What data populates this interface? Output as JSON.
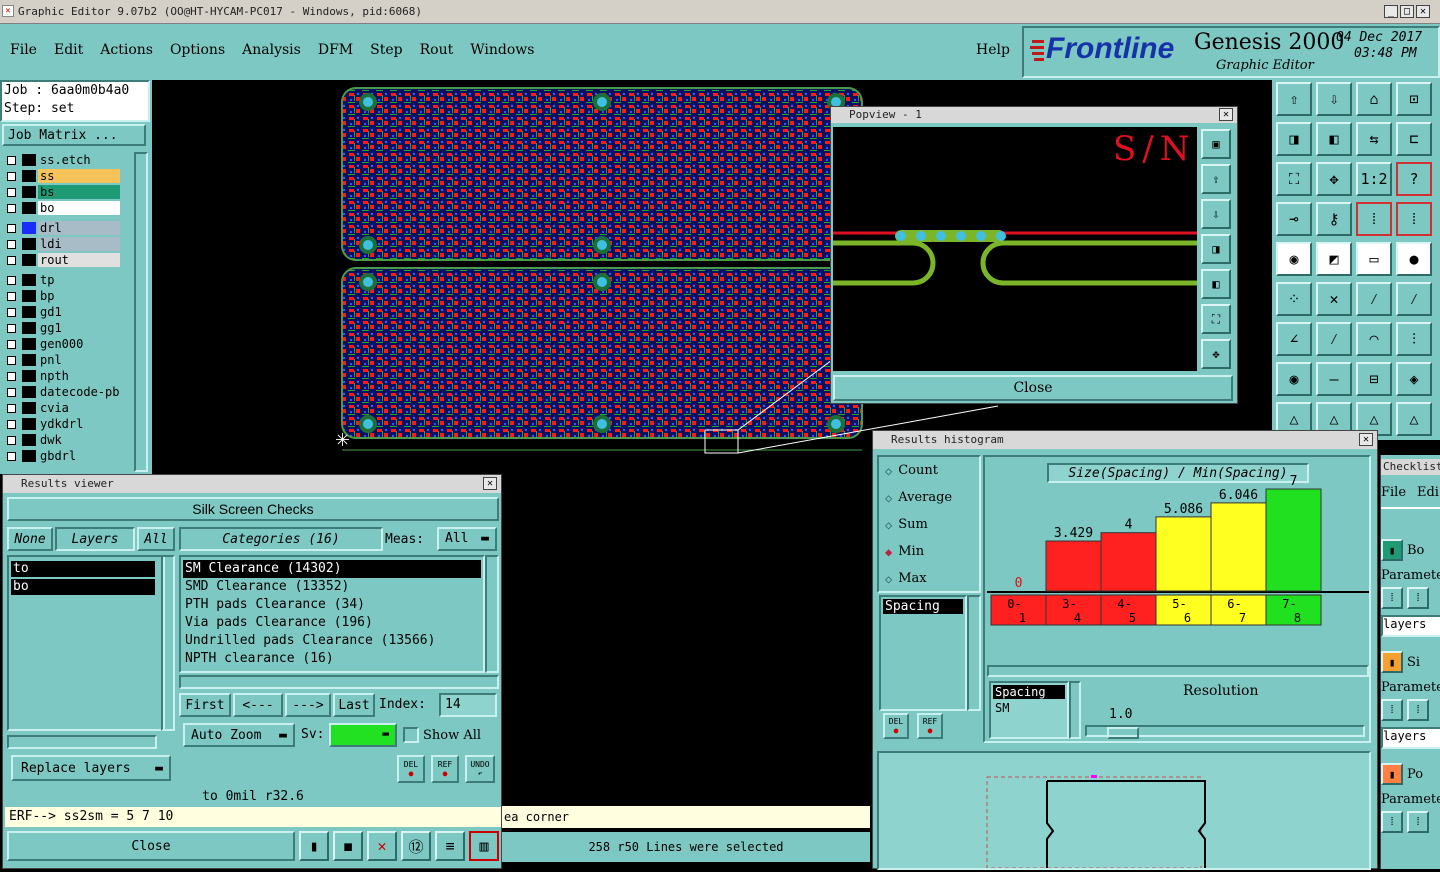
{
  "window": {
    "title": "Graphic Editor 9.07b2 (OO@HT-HYCAM-PC017 - Windows, pid:6068)"
  },
  "menu": {
    "items": [
      "File",
      "Edit",
      "Actions",
      "Options",
      "Analysis",
      "DFM",
      "Step",
      "Rout",
      "Windows"
    ],
    "help": "Help"
  },
  "brand": {
    "logo": "Frontline",
    "product": "Genesis 2000",
    "subtitle": "Graphic Editor",
    "date": "04 Dec 2017",
    "time": "03:48 PM"
  },
  "job": {
    "job_label": "Job : 6aa0m0b4a0",
    "step_label": "Step: set",
    "matrix_button": "Job Matrix ..."
  },
  "layers": [
    {
      "name": "ss.etch",
      "color": "#7ec8c4"
    },
    {
      "name": "ss",
      "color": "#f5c35a"
    },
    {
      "name": "bs",
      "color": "#1e9a74"
    },
    {
      "name": "bo",
      "color": "#ffffff"
    },
    {
      "name": "drl",
      "color": "#a7bcc6"
    },
    {
      "name": "ldi",
      "color": "#a7bcc6"
    },
    {
      "name": "rout",
      "color": "#e0e0e0"
    },
    {
      "name": "tp",
      "color": "#7ec8c4"
    },
    {
      "name": "bp",
      "color": "#7ec8c4"
    },
    {
      "name": "gd1",
      "color": "#7ec8c4"
    },
    {
      "name": "gg1",
      "color": "#7ec8c4"
    },
    {
      "name": "gen000",
      "color": "#7ec8c4"
    },
    {
      "name": "pnl",
      "color": "#7ec8c4"
    },
    {
      "name": "npth",
      "color": "#7ec8c4"
    },
    {
      "name": "datecode-pbc",
      "color": "#7ec8c4"
    },
    {
      "name": "cvia",
      "color": "#7ec8c4"
    },
    {
      "name": "ydkdrl",
      "color": "#7ec8c4"
    },
    {
      "name": "dwk",
      "color": "#7ec8c4"
    },
    {
      "name": "gbdrl",
      "color": "#7ec8c4"
    }
  ],
  "popview": {
    "title": "Popview - 1",
    "text": "S/N",
    "close": "Close"
  },
  "results_viewer": {
    "title": "Results viewer",
    "header": "Silk Screen Checks",
    "none": "None",
    "layers": "Layers",
    "all": "All",
    "categories": "Categories (16)",
    "meas_label": "Meas:",
    "meas_value": "All",
    "layer_items": [
      "to",
      "bo"
    ],
    "category_items": [
      "SM Clearance (14302)",
      "SMD Clearance (13352)",
      "PTH pads Clearance (34)",
      "Via pads Clearance (196)",
      "Undrilled pads Clearance (13566)",
      "NPTH clearance (16)"
    ],
    "first": "First",
    "prev": "<---",
    "next": "--->",
    "last": "Last",
    "index_label": "Index:",
    "index_value": "14",
    "auto_zoom": "Auto Zoom",
    "sv_label": "Sv:",
    "show_all": "Show All",
    "replace_layers": "Replace layers",
    "del": "DEL",
    "ref": "REF",
    "undo": "UNDO",
    "status": "to  0mil  r32.6",
    "erf": "ERF--> ss2sm = 5 7 10",
    "close": "Close"
  },
  "statusbar": {
    "msg1": "ea corner",
    "msg2": "258 r50 Lines were selected"
  },
  "histogram": {
    "title": "Results histogram",
    "options": [
      "Count",
      "Average",
      "Sum",
      "Min",
      "Max"
    ],
    "selected": "Min",
    "chart_title": "Size(Spacing) / Min(Spacing)",
    "list_item": "Spacing",
    "del": "DEL",
    "ref": "REF",
    "spacing_label": "Spacing",
    "sm_label": "SM",
    "resolution_label": "Resolution",
    "resolution_value": "1.0"
  },
  "chart_data": {
    "type": "bar",
    "categories": [
      "0-1",
      "3-4",
      "4-5",
      "5-6",
      "6-7",
      "7-8"
    ],
    "values": [
      0,
      3.429,
      4,
      5.086,
      6.046,
      7
    ],
    "labels": [
      "0",
      "3.429",
      "4",
      "5.086",
      "6.046",
      "7"
    ],
    "colors": [
      "#ff2020",
      "#ff2020",
      "#ff2020",
      "#ffff20",
      "#ffff20",
      "#20e020"
    ],
    "ylim": [
      0,
      7
    ]
  },
  "checklist": {
    "title": "Checklist",
    "file": "File",
    "edit": "Edi",
    "param": "Paramete",
    "layers": "layers",
    "items": [
      "Bo",
      "Si",
      "Po"
    ]
  }
}
